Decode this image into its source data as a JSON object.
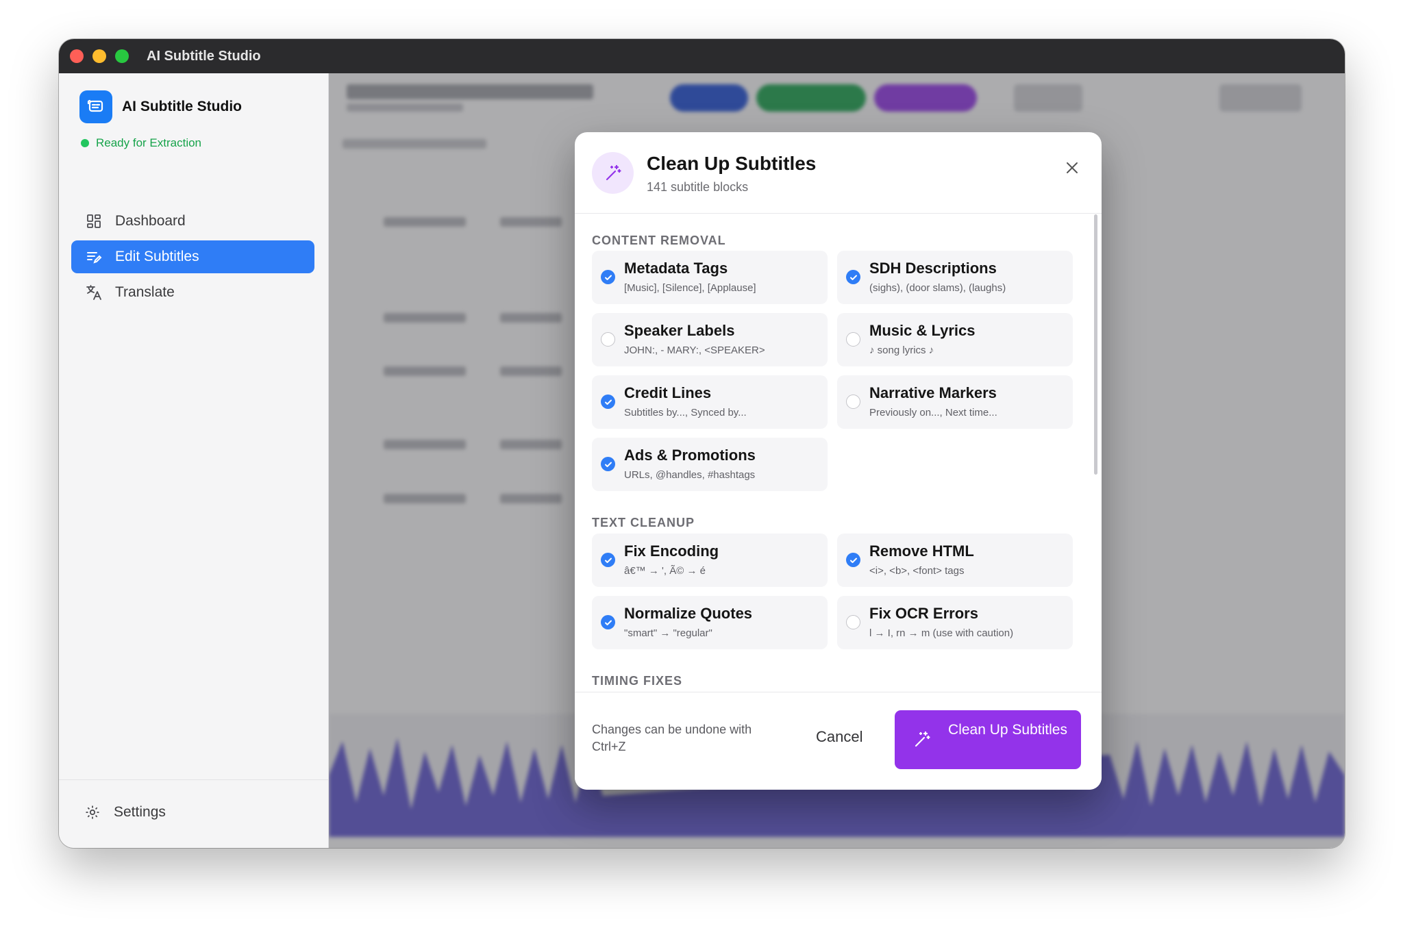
{
  "window": {
    "title": "AI Subtitle Studio"
  },
  "sidebar": {
    "brand_name": "AI Subtitle Studio",
    "status_text": "Ready for Extraction",
    "items": [
      {
        "label": "Dashboard",
        "icon": "dashboard-icon",
        "active": false
      },
      {
        "label": "Edit Subtitles",
        "icon": "edit-subtitles-icon",
        "active": true
      },
      {
        "label": "Translate",
        "icon": "translate-icon",
        "active": false
      }
    ],
    "settings_label": "Settings"
  },
  "modal": {
    "title": "Clean Up Subtitles",
    "subtitle": "141 subtitle blocks",
    "sections": {
      "content_removal": "CONTENT REMOVAL",
      "text_cleanup": "TEXT CLEANUP",
      "timing_fixes": "TIMING FIXES"
    },
    "content_removal": [
      {
        "label": "Metadata Tags",
        "desc": "[Music], [Silence], [Applause]",
        "checked": true
      },
      {
        "label": "SDH Descriptions",
        "desc": "(sighs), (door slams), (laughs)",
        "checked": true
      },
      {
        "label": "Speaker Labels",
        "desc": "JOHN:, - MARY:, <SPEAKER>",
        "checked": false
      },
      {
        "label": "Music & Lyrics",
        "desc": "♪ song lyrics ♪",
        "checked": false
      },
      {
        "label": "Credit Lines",
        "desc": "Subtitles by..., Synced by...",
        "checked": true
      },
      {
        "label": "Narrative Markers",
        "desc": "Previously on..., Next time...",
        "checked": false
      },
      {
        "label": "Ads & Promotions",
        "desc": "URLs, @handles, #hashtags",
        "checked": true
      }
    ],
    "text_cleanup": [
      {
        "label": "Fix Encoding",
        "desc": "â€™ → ', Ã© → é",
        "checked": true
      },
      {
        "label": "Remove HTML",
        "desc": "<i>, <b>, <font> tags",
        "checked": true
      },
      {
        "label": "Normalize Quotes",
        "desc": "\"smart\" → \"regular\"",
        "checked": true
      },
      {
        "label": "Fix OCR Errors",
        "desc": "l → I, rn → m (use with caution)",
        "checked": false
      }
    ],
    "footer_note": "Changes can be undone with Ctrl+Z",
    "cancel_label": "Cancel",
    "primary_label": "Clean Up Subtitles"
  },
  "colors": {
    "accent_blue": "#2f7df6",
    "accent_purple": "#9333ea",
    "status_green": "#16a34a",
    "waveform": "#4338ca"
  }
}
